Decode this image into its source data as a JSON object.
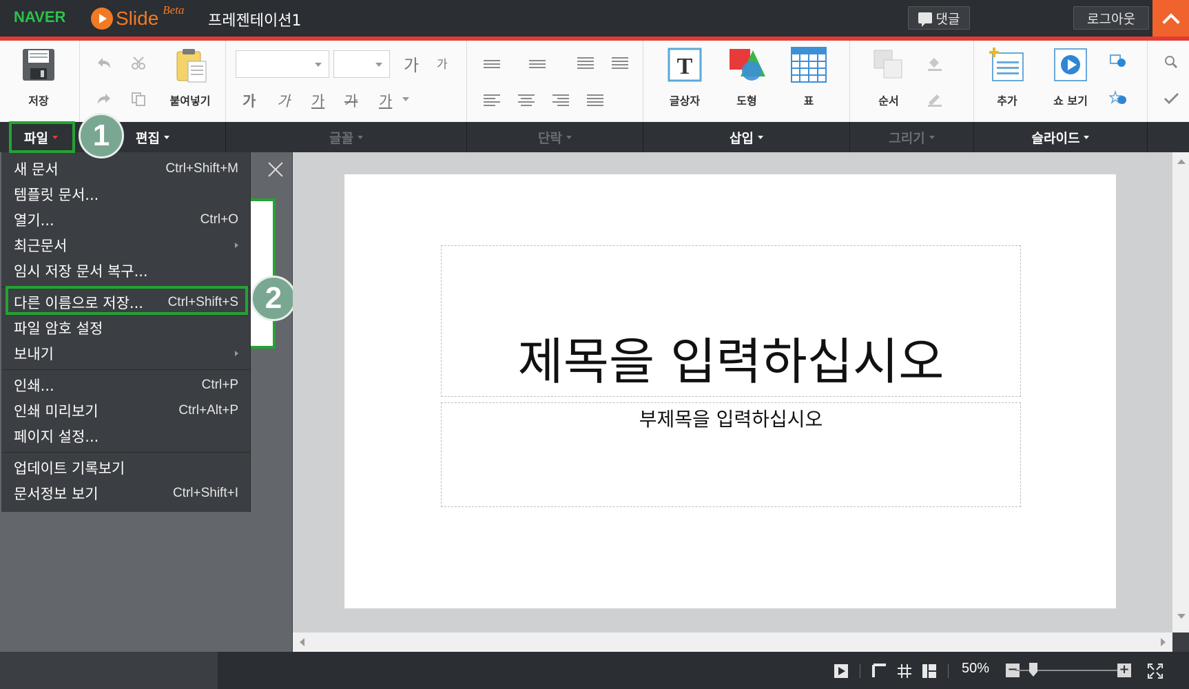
{
  "header": {
    "brand": "NAVER",
    "app_name": "Slide",
    "app_badge": "Beta",
    "doc_title": "프레젠테이션1",
    "comment_label": "댓글",
    "logout_label": "로그아웃"
  },
  "ribbon": {
    "save_label": "저장",
    "paste_label": "붙여넣기",
    "text_box_label": "글상자",
    "shape_label": "도형",
    "table_label": "표",
    "order_label": "순서",
    "add_label": "추가",
    "show_label": "쇼 보기",
    "font_size_up": "가",
    "font_size_down": "가",
    "format_letters": [
      "가",
      "가",
      "가",
      "가",
      "가"
    ]
  },
  "group_labels": {
    "file": "파일",
    "edit": "편집",
    "font": "글꼴",
    "paragraph": "단락",
    "insert": "삽입",
    "draw": "그리기",
    "slide": "슬라이드"
  },
  "file_menu": {
    "items": [
      {
        "label": "새 문서",
        "shortcut": "Ctrl+Shift+M"
      },
      {
        "label": "템플릿 문서...",
        "shortcut": ""
      },
      {
        "label": "열기...",
        "shortcut": "Ctrl+O"
      },
      {
        "label": "최근문서",
        "shortcut": ""
      },
      {
        "label": "임시 저장 문서 복구...",
        "shortcut": ""
      },
      {
        "label": "다른 이름으로 저장...",
        "shortcut": "Ctrl+Shift+S"
      },
      {
        "label": "파일 암호 설정",
        "shortcut": ""
      },
      {
        "label": "보내기",
        "shortcut": ""
      },
      {
        "label": "인쇄...",
        "shortcut": "Ctrl+P"
      },
      {
        "label": "인쇄 미리보기",
        "shortcut": "Ctrl+Alt+P"
      },
      {
        "label": "페이지 설정...",
        "shortcut": ""
      },
      {
        "label": "업데이트 기록보기",
        "shortcut": ""
      },
      {
        "label": "문서정보 보기",
        "shortcut": "Ctrl+Shift+I"
      }
    ]
  },
  "annotations": {
    "step1": "1",
    "step2": "2"
  },
  "slide": {
    "title_placeholder": "제목을 입력하십시오",
    "subtitle_placeholder": "부제목을 입력하십시오"
  },
  "status": {
    "zoom": "50%"
  },
  "colors": {
    "accent_red": "#e23b32",
    "naver_green": "#2bc24a",
    "slide_orange": "#f27a24",
    "highlight_green": "#24a334"
  }
}
